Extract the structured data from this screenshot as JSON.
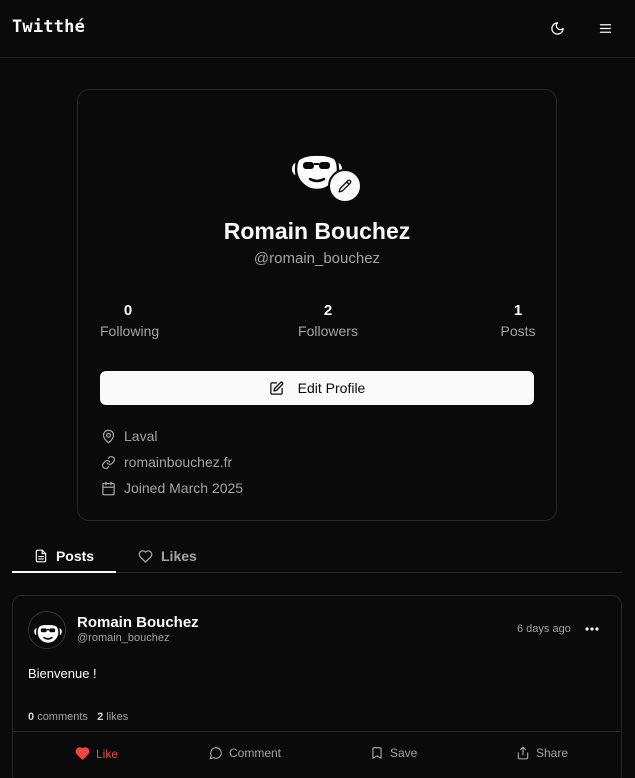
{
  "header": {
    "logo": "Twitthé",
    "theme_icon": "moon-icon",
    "menu_icon": "hamburger-menu-icon"
  },
  "profile": {
    "name": "Romain Bouchez",
    "handle": "@romain_bouchez",
    "stats": [
      {
        "value": "0",
        "label": "Following"
      },
      {
        "value": "2",
        "label": "Followers"
      },
      {
        "value": "1",
        "label": "Posts"
      }
    ],
    "edit_button": "Edit Profile",
    "location": "Laval",
    "website": "romainbouchez.fr",
    "joined": "Joined March 2025"
  },
  "tabs": [
    {
      "label": "Posts",
      "icon": "document-icon",
      "active": true
    },
    {
      "label": "Likes",
      "icon": "heart-outline-icon",
      "active": false
    }
  ],
  "post": {
    "author": "Romain Bouchez",
    "handle": "@romain_bouchez",
    "time": "6 days ago",
    "body": "Bienvenue !",
    "comments_count": "0",
    "comments_label": "comments",
    "likes_count": "2",
    "likes_label": "likes",
    "actions": {
      "like": "Like",
      "comment": "Comment",
      "save": "Save",
      "share": "Share"
    }
  },
  "colors": {
    "background": "#0a0a0a",
    "border": "#262626",
    "text": "#fafafa",
    "muted": "#a3a3a3",
    "like_red": "#ef4444"
  }
}
